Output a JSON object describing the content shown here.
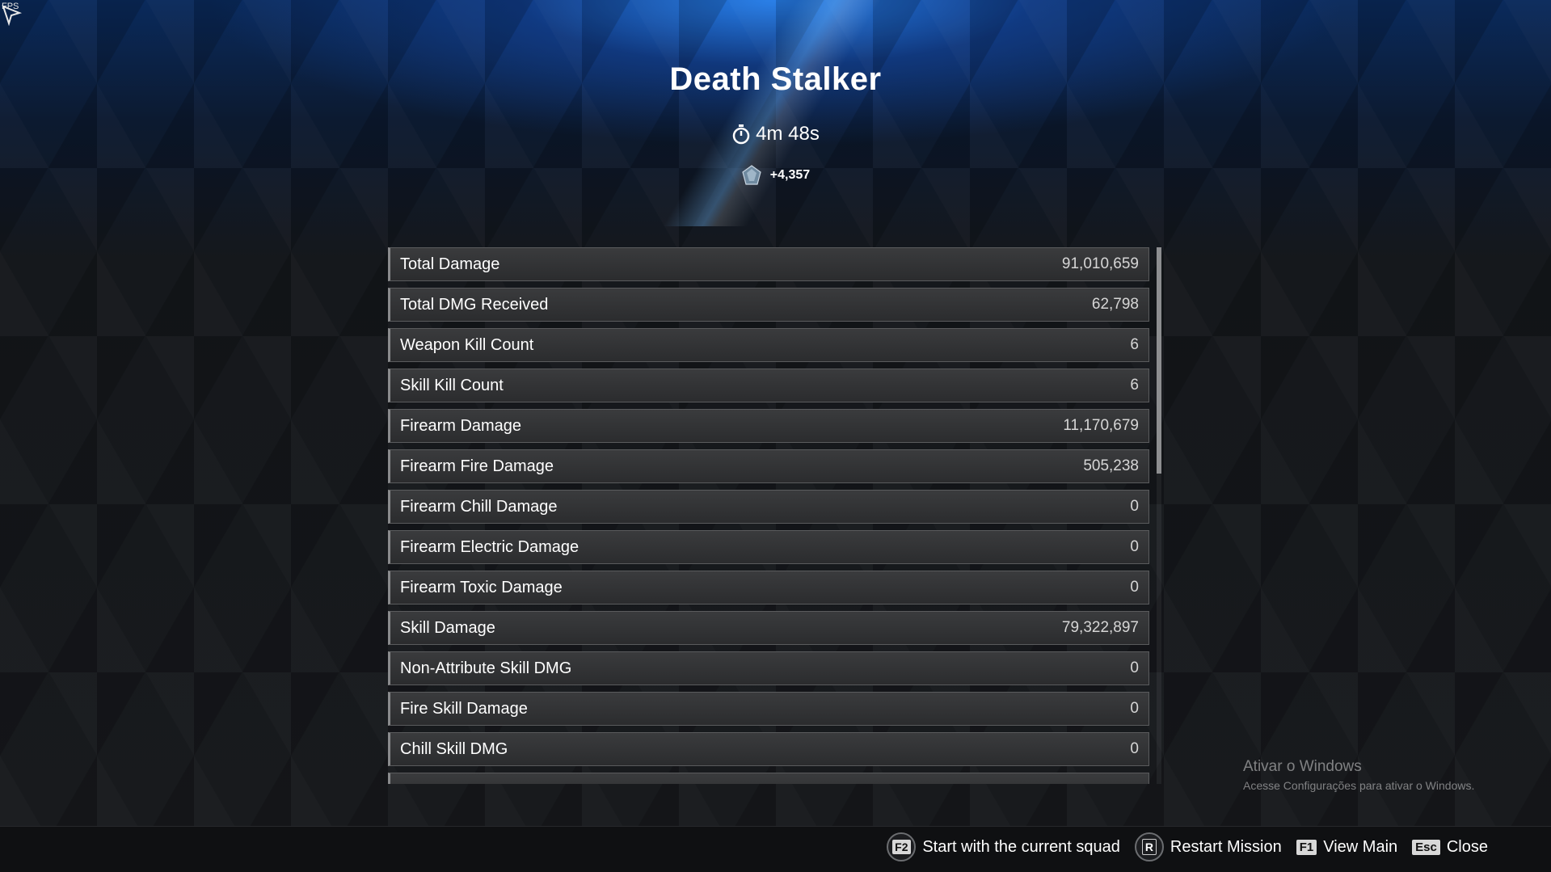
{
  "overlay": {
    "fps_label": "FPS"
  },
  "header": {
    "title": "Death Stalker",
    "timer": "4m 48s",
    "reward": "+4,357"
  },
  "stats": [
    {
      "label": "Total Damage",
      "value": "91,010,659"
    },
    {
      "label": "Total DMG Received",
      "value": "62,798"
    },
    {
      "label": "Weapon Kill Count",
      "value": "6"
    },
    {
      "label": "Skill Kill Count",
      "value": "6"
    },
    {
      "label": "Firearm Damage",
      "value": "11,170,679"
    },
    {
      "label": "Firearm Fire Damage",
      "value": "505,238"
    },
    {
      "label": "Firearm Chill Damage",
      "value": "0"
    },
    {
      "label": "Firearm Electric Damage",
      "value": "0"
    },
    {
      "label": "Firearm Toxic Damage",
      "value": "0"
    },
    {
      "label": "Skill Damage",
      "value": "79,322,897"
    },
    {
      "label": "Non-Attribute Skill DMG",
      "value": "0"
    },
    {
      "label": "Fire Skill Damage",
      "value": "0"
    },
    {
      "label": "Chill Skill DMG",
      "value": "0"
    },
    {
      "label": "",
      "value": ""
    }
  ],
  "watermark": {
    "title": "Ativar o Windows",
    "subtitle": "Acesse Configurações para ativar o Windows."
  },
  "actions": {
    "start_key": "F2",
    "start_label": "Start with the current squad",
    "restart_key": "R",
    "restart_label": "Restart Mission",
    "view_key": "F1",
    "view_label": "View Main",
    "close_key": "Esc",
    "close_label": "Close"
  },
  "icons": {
    "timer": "stopwatch-icon",
    "reward": "crystal-reward-icon",
    "cursor": "arrow-cursor-icon"
  },
  "colors": {
    "accent_blue": "#2a8cf0",
    "row_bg": "#2f3032",
    "row_border": "#5a5b5d",
    "text": "#ffffff"
  }
}
